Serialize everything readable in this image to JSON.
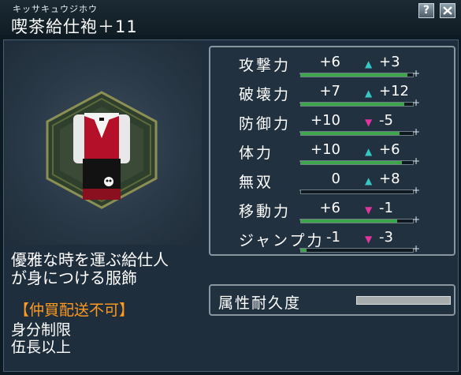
{
  "item": {
    "ruby": "キッサキュウジホウ",
    "name": "喫茶給仕袍＋11"
  },
  "header": {
    "help_label": "?",
    "close_label": "X"
  },
  "description": {
    "line1": "優雅な時を運ぶ給仕人",
    "line2": "が身につける服飾"
  },
  "warning": "【仲買配送不可】",
  "requirement": {
    "line1": "身分制限",
    "line2": "伍長以上"
  },
  "stats": [
    {
      "label": "攻撃力",
      "value": "+6",
      "bonus": "+3",
      "arrow": "up",
      "fill": 0.95
    },
    {
      "label": "破壊力",
      "value": "+7",
      "bonus": "+12",
      "arrow": "up",
      "fill": 0.92
    },
    {
      "label": "防御力",
      "value": "+10",
      "bonus": "-5",
      "arrow": "down",
      "fill": 0.88
    },
    {
      "label": "体力",
      "value": "+10",
      "bonus": "+6",
      "arrow": "up",
      "fill": 0.9
    },
    {
      "label": "無双",
      "value": "0",
      "bonus": "+8",
      "arrow": "up",
      "fill": 0.0
    },
    {
      "label": "移動力",
      "value": "+6",
      "bonus": "-1",
      "arrow": "down",
      "fill": 0.86
    },
    {
      "label": "ジャンプ力",
      "value": "-1",
      "bonus": "-3",
      "arrow": "down",
      "fill": 0.05
    }
  ],
  "durability": {
    "label": "属性耐久度",
    "fill": 1.0
  },
  "colors": {
    "up_arrow": "#36c6c3",
    "down_arrow": "#e0359c",
    "warning": "#ff9a1f",
    "bar_fill": "#3ea64a"
  }
}
